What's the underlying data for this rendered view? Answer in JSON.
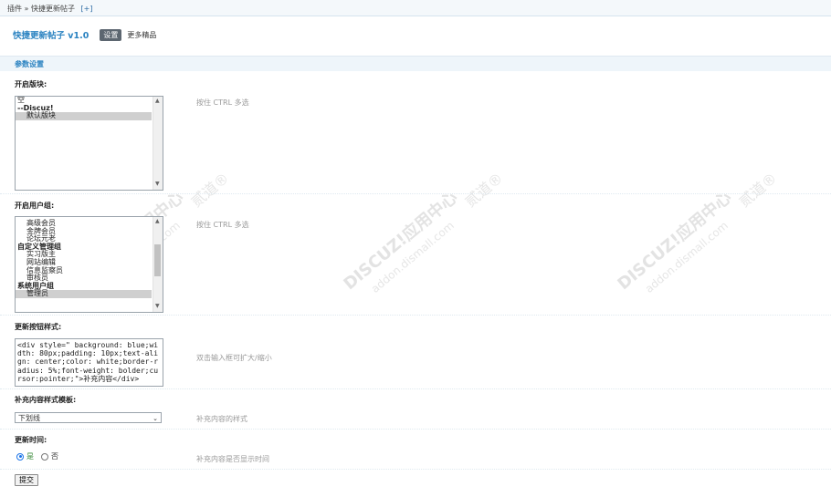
{
  "breadcrumb": {
    "text": "插件 » 快捷更新帖子",
    "add": "[+]"
  },
  "header": {
    "title": "快捷更新帖子 v1.0",
    "tab_current": "设置",
    "tab_more": "更多精品"
  },
  "section": {
    "title": "参数设置"
  },
  "fields": {
    "forums": {
      "label": "开启版块:",
      "tip": "按住 CTRL 多选",
      "options": [
        "空",
        "--Discuz!",
        "默认版块"
      ]
    },
    "groups": {
      "label": "开启用户组:",
      "tip": "按住 CTRL 多选",
      "options": [
        "高级会员",
        "金牌会员",
        "论坛元老",
        "自定义管理组",
        "实习版主",
        "网站编辑",
        "信息监察员",
        "审核员",
        "系统用户组",
        "管理员"
      ]
    },
    "button_style": {
      "label": "更新按钮样式:",
      "value": "<div style=\" background: blue;width: 80px;padding: 10px;text-align: center;color: white;border-radius: 5%;font-weight: bolder;cursor:pointer;\">补充内容</div>",
      "tip": "双击输入框可扩大/缩小"
    },
    "template": {
      "label": "补充内容样式模板:",
      "selected": "下划线",
      "tip": "补充内容的样式"
    },
    "show_time": {
      "label": "更新时间:",
      "yes": "是",
      "no": "否",
      "tip": "补充内容是否显示时间"
    }
  },
  "submit_label": "提交",
  "watermark": {
    "brand": "DISCUZ!应用中心",
    "site": "addon.dismall.com",
    "mark": "贰道®"
  },
  "colors": {
    "accent": "#2b83c1",
    "section_bg": "#eef5fa",
    "tab_bg": "#5c6670"
  },
  "icons": [
    "chevron-down-icon",
    "scroll-up-icon",
    "scroll-down-icon",
    "radio-icon"
  ]
}
